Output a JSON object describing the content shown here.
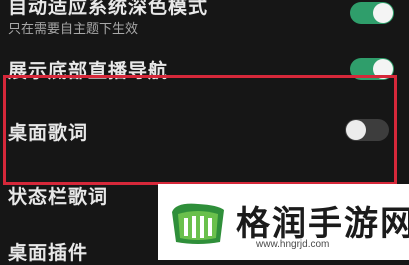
{
  "settings": {
    "items": [
      {
        "title": "自动适应系统深色模式",
        "subtitle": "只在需要自主题下生效",
        "toggle": "on"
      },
      {
        "title": "展示底部直播导航",
        "toggle": "on"
      },
      {
        "title": "桌面歌词",
        "toggle": "off"
      },
      {
        "title": "状态栏歌词"
      },
      {
        "title": "桌面插件"
      }
    ]
  },
  "watermark": {
    "brand": "格润手游网",
    "url": "www.hngrjd.com"
  },
  "colors": {
    "background": "#161616",
    "toggle_on": "#2f9e6b",
    "toggle_off": "#3d3d3d",
    "highlight_border": "#d6283a"
  }
}
